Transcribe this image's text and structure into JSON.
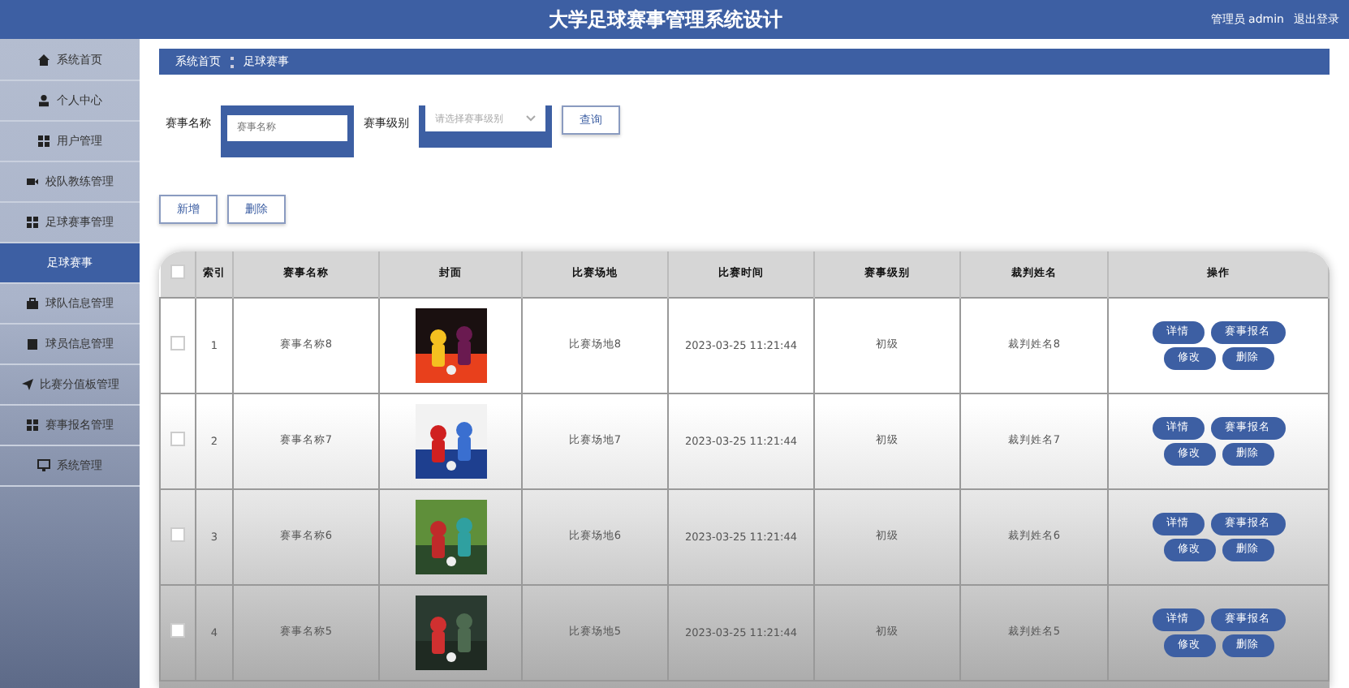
{
  "header": {
    "title": "大学足球赛事管理系统设计",
    "user": "管理员 admin",
    "logout": "退出登录"
  },
  "sidebar": {
    "items": [
      {
        "label": "系统首页",
        "selected": false
      },
      {
        "label": "个人中心",
        "selected": false
      },
      {
        "label": "用户管理",
        "selected": false
      },
      {
        "label": "校队教练管理",
        "selected": false
      },
      {
        "label": "足球赛事管理",
        "selected": false
      },
      {
        "label": "足球赛事",
        "selected": true
      },
      {
        "label": "球队信息管理",
        "selected": false
      },
      {
        "label": "球员信息管理",
        "selected": false
      },
      {
        "label": "比赛分值板管理",
        "selected": false
      },
      {
        "label": "赛事报名管理",
        "selected": false
      },
      {
        "label": "系统管理",
        "selected": false
      }
    ]
  },
  "breadcrumb": [
    "系统首页",
    "足球赛事"
  ],
  "search": {
    "fields": [
      {
        "label": "赛事名称",
        "placeholder": "赛事名称",
        "kind": "text"
      },
      {
        "label": "赛事级别",
        "placeholder": "请选择赛事级别",
        "kind": "select"
      }
    ],
    "button": "查询"
  },
  "actions": [
    "新增",
    "删除"
  ],
  "table": {
    "select_all": {
      "checked": false
    },
    "columns": [
      "索引",
      "赛事名称",
      "封面",
      "比赛场地",
      "比赛时间",
      "赛事级别",
      "裁判姓名",
      "操作"
    ],
    "rows": [
      {
        "index": "1",
        "name": "赛事名称8",
        "venue": "比赛场地8",
        "time": "2023-03-25 11:21:44",
        "level": "初级",
        "referee": "裁判姓名8",
        "checked": false,
        "buttons": [
          "详情",
          "赛事报名",
          "修改",
          "删除"
        ]
      },
      {
        "index": "2",
        "name": "赛事名称7",
        "venue": "比赛场地7",
        "time": "2023-03-25 11:21:44",
        "level": "初级",
        "referee": "裁判姓名7",
        "checked": false,
        "buttons": [
          "详情",
          "赛事报名",
          "修改",
          "删除"
        ]
      },
      {
        "index": "3",
        "name": "赛事名称6",
        "venue": "比赛场地6",
        "time": "2023-03-25 11:21:44",
        "level": "初级",
        "referee": "裁判姓名6",
        "checked": false,
        "buttons": [
          "详情",
          "赛事报名",
          "修改",
          "删除"
        ]
      },
      {
        "index": "4",
        "name": "赛事名称5",
        "venue": "比赛场地5",
        "time": "2023-03-25 11:21:44",
        "level": "初级",
        "referee": "裁判姓名5",
        "checked": false,
        "buttons": [
          "详情",
          "赛事报名",
          "修改",
          "删除"
        ]
      }
    ]
  }
}
